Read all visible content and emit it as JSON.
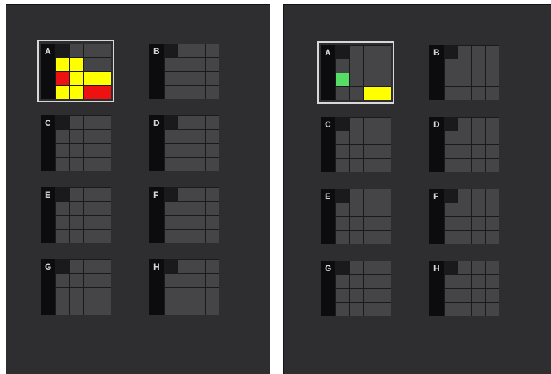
{
  "colors": {
    "panel_bg": "#2e2e31",
    "pad_off": "#454548",
    "yellow": "#ffff00",
    "red": "#ee1111",
    "green": "#55dd66"
  },
  "panels": [
    {
      "name": "left",
      "selected_group": "A",
      "groups": [
        {
          "label": "A",
          "pads": [
            [
              "empty",
              "off",
              "off",
              "off"
            ],
            [
              "yellow",
              "yellow",
              "off",
              "off"
            ],
            [
              "red",
              "yellow",
              "yellow",
              "yellow"
            ],
            [
              "yellow",
              "yellow",
              "red",
              "red"
            ]
          ]
        },
        {
          "label": "B",
          "pads": [
            [
              "empty",
              "off",
              "off",
              "off"
            ],
            [
              "off",
              "off",
              "off",
              "off"
            ],
            [
              "off",
              "off",
              "off",
              "off"
            ],
            [
              "off",
              "off",
              "off",
              "off"
            ]
          ]
        },
        {
          "label": "C",
          "pads": [
            [
              "empty",
              "off",
              "off",
              "off"
            ],
            [
              "off",
              "off",
              "off",
              "off"
            ],
            [
              "off",
              "off",
              "off",
              "off"
            ],
            [
              "off",
              "off",
              "off",
              "off"
            ]
          ]
        },
        {
          "label": "D",
          "pads": [
            [
              "empty",
              "off",
              "off",
              "off"
            ],
            [
              "off",
              "off",
              "off",
              "off"
            ],
            [
              "off",
              "off",
              "off",
              "off"
            ],
            [
              "off",
              "off",
              "off",
              "off"
            ]
          ]
        },
        {
          "label": "E",
          "pads": [
            [
              "empty",
              "off",
              "off",
              "off"
            ],
            [
              "off",
              "off",
              "off",
              "off"
            ],
            [
              "off",
              "off",
              "off",
              "off"
            ],
            [
              "off",
              "off",
              "off",
              "off"
            ]
          ]
        },
        {
          "label": "F",
          "pads": [
            [
              "empty",
              "off",
              "off",
              "off"
            ],
            [
              "off",
              "off",
              "off",
              "off"
            ],
            [
              "off",
              "off",
              "off",
              "off"
            ],
            [
              "off",
              "off",
              "off",
              "off"
            ]
          ]
        },
        {
          "label": "G",
          "pads": [
            [
              "empty",
              "off",
              "off",
              "off"
            ],
            [
              "off",
              "off",
              "off",
              "off"
            ],
            [
              "off",
              "off",
              "off",
              "off"
            ],
            [
              "off",
              "off",
              "off",
              "off"
            ]
          ]
        },
        {
          "label": "H",
          "pads": [
            [
              "empty",
              "off",
              "off",
              "off"
            ],
            [
              "off",
              "off",
              "off",
              "off"
            ],
            [
              "off",
              "off",
              "off",
              "off"
            ],
            [
              "off",
              "off",
              "off",
              "off"
            ]
          ]
        }
      ]
    },
    {
      "name": "right",
      "selected_group": "A",
      "groups": [
        {
          "label": "A",
          "pads": [
            [
              "empty",
              "off",
              "off",
              "off"
            ],
            [
              "off",
              "off",
              "off",
              "off"
            ],
            [
              "green",
              "off",
              "off",
              "off"
            ],
            [
              "off",
              "off",
              "yellow",
              "yellow"
            ]
          ]
        },
        {
          "label": "B",
          "pads": [
            [
              "empty",
              "off",
              "off",
              "off"
            ],
            [
              "off",
              "off",
              "off",
              "off"
            ],
            [
              "off",
              "off",
              "off",
              "off"
            ],
            [
              "off",
              "off",
              "off",
              "off"
            ]
          ]
        },
        {
          "label": "C",
          "pads": [
            [
              "empty",
              "off",
              "off",
              "off"
            ],
            [
              "off",
              "off",
              "off",
              "off"
            ],
            [
              "off",
              "off",
              "off",
              "off"
            ],
            [
              "off",
              "off",
              "off",
              "off"
            ]
          ]
        },
        {
          "label": "D",
          "pads": [
            [
              "empty",
              "off",
              "off",
              "off"
            ],
            [
              "off",
              "off",
              "off",
              "off"
            ],
            [
              "off",
              "off",
              "off",
              "off"
            ],
            [
              "off",
              "off",
              "off",
              "off"
            ]
          ]
        },
        {
          "label": "E",
          "pads": [
            [
              "empty",
              "off",
              "off",
              "off"
            ],
            [
              "off",
              "off",
              "off",
              "off"
            ],
            [
              "off",
              "off",
              "off",
              "off"
            ],
            [
              "off",
              "off",
              "off",
              "off"
            ]
          ]
        },
        {
          "label": "F",
          "pads": [
            [
              "empty",
              "off",
              "off",
              "off"
            ],
            [
              "off",
              "off",
              "off",
              "off"
            ],
            [
              "off",
              "off",
              "off",
              "off"
            ],
            [
              "off",
              "off",
              "off",
              "off"
            ]
          ]
        },
        {
          "label": "G",
          "pads": [
            [
              "empty",
              "off",
              "off",
              "off"
            ],
            [
              "off",
              "off",
              "off",
              "off"
            ],
            [
              "off",
              "off",
              "off",
              "off"
            ],
            [
              "off",
              "off",
              "off",
              "off"
            ]
          ]
        },
        {
          "label": "H",
          "pads": [
            [
              "empty",
              "off",
              "off",
              "off"
            ],
            [
              "off",
              "off",
              "off",
              "off"
            ],
            [
              "off",
              "off",
              "off",
              "off"
            ],
            [
              "off",
              "off",
              "off",
              "off"
            ]
          ]
        }
      ]
    }
  ]
}
